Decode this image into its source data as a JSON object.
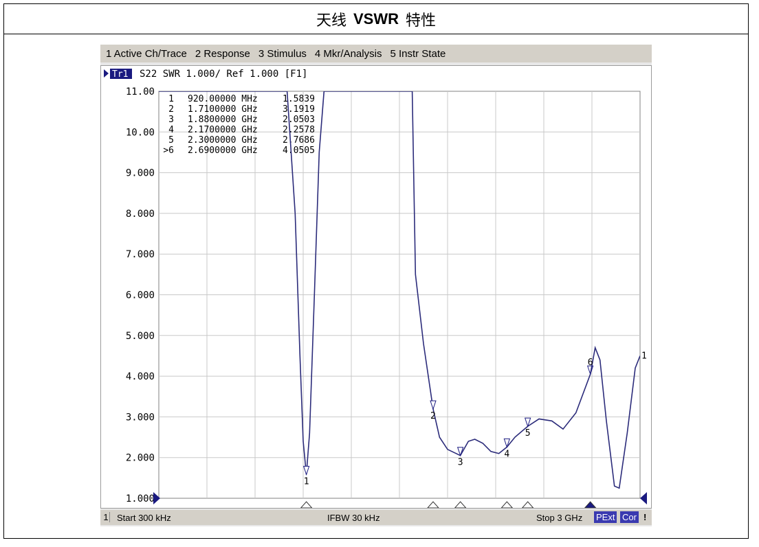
{
  "page": {
    "title_prefix": "天线",
    "title_latin": "VSWR",
    "title_suffix": "特性"
  },
  "menu": [
    "1 Active Ch/Trace",
    "2 Response",
    "3 Stimulus",
    "4 Mkr/Analysis",
    "5 Instr State"
  ],
  "trace_header": {
    "tag": "Tr1",
    "text": "S22  SWR 1.000/ Ref 1.000 [F1]"
  },
  "markers": [
    {
      "id": "1",
      "freq": "920.00000 MHz",
      "value": "1.5839"
    },
    {
      "id": "2",
      "freq": "1.7100000 GHz",
      "value": "3.1919"
    },
    {
      "id": "3",
      "freq": "1.8800000 GHz",
      "value": "2.0503"
    },
    {
      "id": "4",
      "freq": "2.1700000 GHz",
      "value": "2.2578"
    },
    {
      "id": "5",
      "freq": "2.3000000 GHz",
      "value": "2.7686"
    },
    {
      "id": ">6",
      "freq": "2.6900000 GHz",
      "value": "4.0505"
    }
  ],
  "status": {
    "channel": "1",
    "start": "Start 300 kHz",
    "ifbw": "IFBW 30 kHz",
    "stop": "Stop 3 GHz",
    "badge1": "PExt",
    "badge2": "Cor",
    "flag": "!"
  },
  "colors": {
    "trace": "#2b2b7a",
    "marker_active": "#1a1a80",
    "grid": "#c8c8c8",
    "badge_bg": "#3a3ab0"
  },
  "chart_data": {
    "type": "line",
    "title": "",
    "xlabel": "",
    "ylabel": "",
    "ylim": [
      1.0,
      11.0
    ],
    "xlim_ghz": [
      0.0003,
      3.0
    ],
    "y_ticks": [
      "1.000",
      "2.000",
      "3.000",
      "4.000",
      "5.000",
      "6.000",
      "7.000",
      "8.000",
      "9.000",
      "10.00",
      "11.00"
    ],
    "grid": true,
    "series": [
      {
        "x": [
          0.0003,
          0.6,
          0.75,
          0.8,
          0.85,
          0.88,
          0.9,
          0.92,
          0.94,
          0.97,
          1.0,
          1.03,
          1.06,
          1.1,
          1.2,
          1.3,
          1.4,
          1.5,
          1.55,
          1.58,
          1.6,
          1.65,
          1.71,
          1.75,
          1.8,
          1.88,
          1.93,
          1.97,
          2.02,
          2.07,
          2.12,
          2.17,
          2.22,
          2.3,
          2.37,
          2.45,
          2.52,
          2.6,
          2.69,
          2.72,
          2.75,
          2.79,
          2.84,
          2.87,
          2.92,
          2.97,
          3.0
        ],
        "y": [
          11.0,
          11.0,
          11.0,
          11.0,
          8.0,
          4.5,
          2.4,
          1.5839,
          2.6,
          6.0,
          9.5,
          11.0,
          11.0,
          11.0,
          11.0,
          11.0,
          11.0,
          11.0,
          11.0,
          11.0,
          6.5,
          4.8,
          3.1919,
          2.5,
          2.2,
          2.0503,
          2.4,
          2.45,
          2.35,
          2.15,
          2.1,
          2.2578,
          2.5,
          2.7686,
          2.95,
          2.9,
          2.7,
          3.1,
          4.0505,
          4.7,
          4.4,
          2.9,
          1.3,
          1.25,
          2.6,
          4.2,
          4.5
        ]
      }
    ],
    "marker_points": [
      {
        "label": "1",
        "x": 0.92,
        "y": 1.5839
      },
      {
        "label": "2",
        "x": 1.71,
        "y": 3.1919
      },
      {
        "label": "3",
        "x": 1.88,
        "y": 2.0503
      },
      {
        "label": "4",
        "x": 2.17,
        "y": 2.2578
      },
      {
        "label": "5",
        "x": 2.3,
        "y": 2.7686
      },
      {
        "label": "6",
        "x": 2.69,
        "y": 4.0505
      }
    ]
  }
}
